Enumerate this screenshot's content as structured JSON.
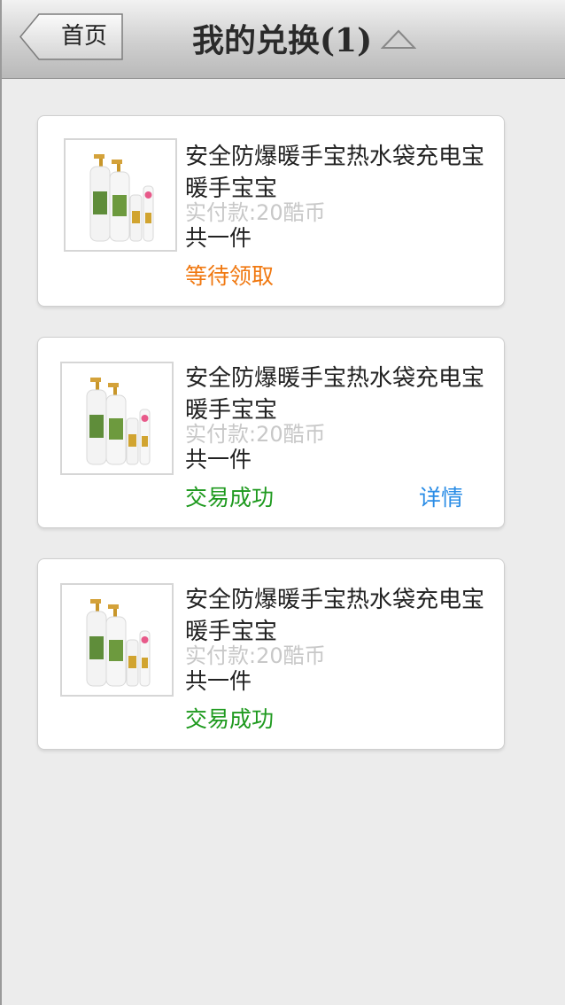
{
  "header": {
    "back_label": "首页",
    "title": "我的兑换(1)"
  },
  "orders": [
    {
      "name": "安全防爆暖手宝热水袋充电宝暖手宝宝",
      "price": "实付款:20酷币",
      "quantity": "共一件",
      "status": "等待领取",
      "status_color": "#f07810"
    },
    {
      "name": "安全防爆暖手宝热水袋充电宝暖手宝宝",
      "price": "实付款:20酷币",
      "quantity": "共一件",
      "status": "交易成功",
      "status_color": "#1f9a1f",
      "detail": "详情",
      "detail_color": "#2b8de6"
    },
    {
      "name": "安全防爆暖手宝热水袋充电宝暖手宝宝",
      "price": "实付款:20酷币",
      "quantity": "共一件",
      "status": "交易成功",
      "status_color": "#1f9a1f"
    }
  ],
  "icons": {
    "back": "back-arrow-icon",
    "title_toggle": "triangle-up-icon",
    "product": "product-image"
  }
}
